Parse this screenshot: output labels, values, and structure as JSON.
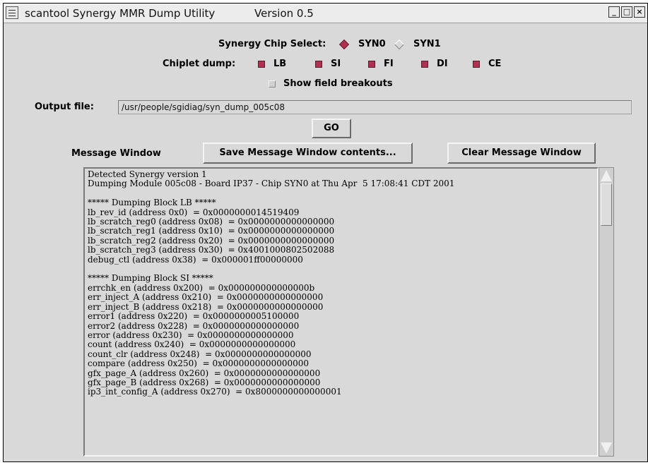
{
  "window": {
    "title": "scantool Synergy MMR Dump Utility",
    "version": "Version 0.5",
    "controls": [
      "minimize-icon",
      "maximize-icon",
      "close-icon"
    ]
  },
  "chip_select": {
    "label": "Synergy Chip Select:",
    "options": [
      {
        "label": "SYN0",
        "selected": true
      },
      {
        "label": "SYN1",
        "selected": false
      }
    ]
  },
  "chiplet": {
    "label": "Chiplet dump:",
    "items": [
      {
        "label": "LB",
        "checked": true
      },
      {
        "label": "SI",
        "checked": true
      },
      {
        "label": "FI",
        "checked": true
      },
      {
        "label": "DI",
        "checked": true
      },
      {
        "label": "CE",
        "checked": true
      }
    ]
  },
  "show_field": {
    "label": "Show field breakouts",
    "checked": false
  },
  "output": {
    "label": "Output file:",
    "value": "/usr/people/sgidiag/syn_dump_005c08"
  },
  "go_label": "GO",
  "message": {
    "label": "Message Window",
    "save_label": "Save Message Window contents...",
    "clear_label": "Clear Message Window",
    "lines": [
      "Detected Synergy version 1",
      "Dumping Module 005c08 - Board IP37 - Chip SYN0 at Thu Apr  5 17:08:41 CDT 2001",
      "",
      "***** Dumping Block LB *****",
      "lb_rev_id (address 0x0)  = 0x0000000014519409",
      "lb_scratch_reg0 (address 0x08)  = 0x0000000000000000",
      "lb_scratch_reg1 (address 0x10)  = 0x0000000000000000",
      "lb_scratch_reg2 (address 0x20)  = 0x0000000000000000",
      "lb_scratch_reg3 (address 0x30)  = 0x4001000802502088",
      "debug_ctl (address 0x38)  = 0x000001ff00000000",
      "",
      "***** Dumping Block SI *****",
      "errchk_en (address 0x200)  = 0x000000000000000b",
      "err_inject_A (address 0x210)  = 0x0000000000000000",
      "err_inject_B (address 0x218)  = 0x0000000000000000",
      "error1 (address 0x220)  = 0x0000000005100000",
      "error2 (address 0x228)  = 0x0000000000000000",
      "error (address 0x230)  = 0x0000000000000000",
      "count (address 0x240)  = 0x0000000000000000",
      "count_clr (address 0x248)  = 0x0000000000000000",
      "compare (address 0x250)  = 0x0000000000000000",
      "gfx_page_A (address 0x260)  = 0x0000000000000000",
      "gfx_page_B (address 0x268)  = 0x0000000000000000",
      "ip3_int_config_A (address 0x270)  = 0x8000000000000001"
    ]
  },
  "colors": {
    "background": "#d9d9d9",
    "accent": "#b03050"
  }
}
